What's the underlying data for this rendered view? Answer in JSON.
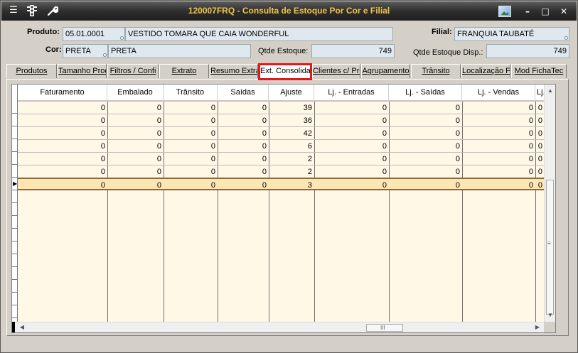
{
  "window": {
    "title": "120007FRQ - Consulta de Estoque Por Cor e Filial",
    "left_icons": [
      "menu-icon",
      "traffic-light-icon",
      "wrench-icon"
    ],
    "right_icons": [
      "picture-icon",
      "minimize-icon",
      "maximize-icon",
      "close-icon"
    ],
    "minimize_glyph": "–",
    "maximize_glyph": "□",
    "close_glyph": "✕"
  },
  "header": {
    "produto_label": "Produto:",
    "produto_code": "05.01.0001",
    "produto_desc": "VESTIDO TOMARA QUE CAIA WONDERFUL",
    "filial_label": "Filial:",
    "filial_value": "FRANQUIA TAUBATÉ",
    "cor_label": "Cor:",
    "cor_code": "PRETA",
    "cor_desc": "PRETA",
    "qtde_estoque_label": "Qtde Estoque:",
    "qtde_estoque_value": "749",
    "qtde_estoque_disp_label": "Qtde Estoque Disp.:",
    "qtde_estoque_disp_value": "749"
  },
  "tabs": [
    {
      "label": "Produtos"
    },
    {
      "label": "Tamanho Prod"
    },
    {
      "label": "Filtros / Confi"
    },
    {
      "label": "Extrato"
    },
    {
      "label": "Resumo Extra"
    },
    {
      "label": "Ext. Consolida",
      "active": true
    },
    {
      "label": "Clientes c/ Pro"
    },
    {
      "label": "Agrupamento"
    },
    {
      "label": "Trânsito"
    },
    {
      "label": "Localização Fil"
    },
    {
      "label": "Mod FichaTec"
    }
  ],
  "grid": {
    "columns": [
      "Faturamento",
      "Embalado",
      "Trânsito",
      "Saídas",
      "Ajuste",
      "Lj. - Entradas",
      "Lj. - Saídas",
      "Lj. - Vendas",
      "Lj. -"
    ],
    "rows": [
      [
        "0",
        "0",
        "0",
        "0",
        "39",
        "0",
        "0",
        "0",
        "0"
      ],
      [
        "0",
        "0",
        "0",
        "0",
        "36",
        "0",
        "0",
        "0",
        "0"
      ],
      [
        "0",
        "0",
        "0",
        "0",
        "42",
        "0",
        "0",
        "0",
        "0"
      ],
      [
        "0",
        "0",
        "0",
        "0",
        "6",
        "0",
        "0",
        "0",
        "0"
      ],
      [
        "0",
        "0",
        "0",
        "0",
        "2",
        "0",
        "0",
        "0",
        "0"
      ],
      [
        "0",
        "0",
        "0",
        "0",
        "2",
        "0",
        "0",
        "0",
        "0"
      ],
      [
        "0",
        "0",
        "0",
        "0",
        "3",
        "0",
        "0",
        "0",
        "0"
      ]
    ],
    "selected_row": 6,
    "row_pointer": "▶",
    "hscroll_grip": "III",
    "vscroll_grip": "≡"
  },
  "colors": {
    "title_text": "#f3c44a",
    "highlight_box": "#e0191a",
    "grid_bg": "#fff8e7",
    "selected_row": "#fde6b4"
  }
}
